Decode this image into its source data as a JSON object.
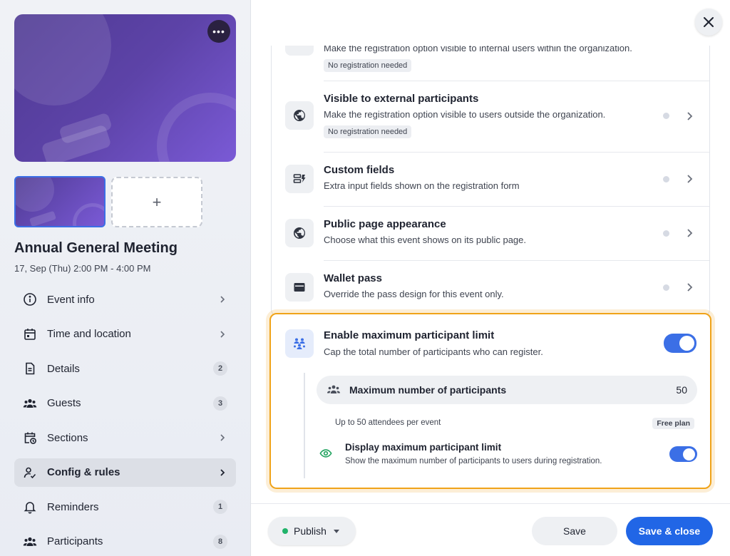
{
  "event": {
    "title": "Annual General Meeting",
    "date": "17, Sep (Thu) 2:00 PM - 4:00 PM",
    "more_label": "•••",
    "add_media_label": "+"
  },
  "nav": {
    "items": [
      {
        "label": "Event info",
        "icon": "info-icon"
      },
      {
        "label": "Time and location",
        "icon": "calendar-icon"
      },
      {
        "label": "Details",
        "icon": "document-icon",
        "count": "2"
      },
      {
        "label": "Guests",
        "icon": "people-icon",
        "count": "3"
      },
      {
        "label": "Sections",
        "icon": "calendar-clock-icon"
      },
      {
        "label": "Config & rules",
        "icon": "user-check-icon",
        "active": true
      },
      {
        "label": "Reminders",
        "icon": "bell-icon",
        "count": "1"
      },
      {
        "label": "Participants",
        "icon": "people-icon",
        "count": "8"
      }
    ]
  },
  "options": {
    "internal": {
      "desc": "Make the registration option visible to internal users within the organization.",
      "tag": "No registration needed"
    },
    "external": {
      "title": "Visible to external participants",
      "desc": "Make the registration option visible to users outside the organization.",
      "tag": "No registration needed"
    },
    "custom_fields": {
      "title": "Custom fields",
      "desc": "Extra input fields shown on the registration form"
    },
    "public_page": {
      "title": "Public page appearance",
      "desc": "Choose what this event shows on its public page."
    },
    "wallet": {
      "title": "Wallet pass",
      "desc": "Override the pass design for this event only."
    }
  },
  "limit": {
    "title": "Enable maximum participant limit",
    "desc": "Cap the total number of participants who can register.",
    "enabled": true,
    "max_label": "Maximum number of participants",
    "max_value": "50",
    "hint": "Up to 50 attendees per event",
    "plan": "Free plan",
    "display_title": "Display maximum participant limit",
    "display_desc": "Show the maximum number of participants to users during registration.",
    "display_enabled": true
  },
  "footer": {
    "publish_label": "Publish",
    "save_label": "Save",
    "save_close_label": "Save & close"
  },
  "colors": {
    "accent": "#2166e6",
    "toggle_on": "#3b6fe6",
    "highlight": "#f0a319",
    "publish_status": "#21b36a",
    "cover_purple": "#5d43a8"
  }
}
